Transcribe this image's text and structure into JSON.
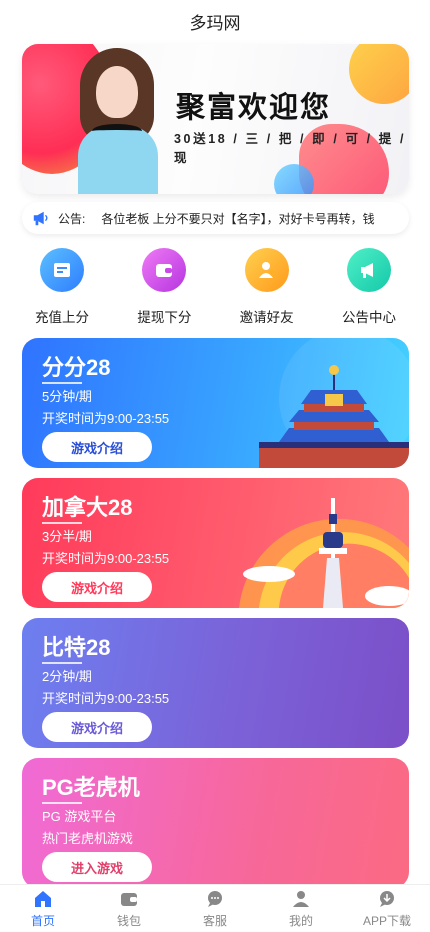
{
  "header": {
    "title": "多玛网"
  },
  "banner": {
    "title": "聚富欢迎您",
    "subtitle": "30送18 / 三 / 把 / 即 / 可 / 提 / 现"
  },
  "notice": {
    "label": "公告:",
    "text": "各位老板    上分不要只对【名字】，对好卡号再转，钱"
  },
  "quick_actions": [
    {
      "label": "充值上分",
      "icon": "recharge-icon",
      "color": "#3a9bff"
    },
    {
      "label": "提现下分",
      "icon": "wallet-icon",
      "color": "#d64be8"
    },
    {
      "label": "邀请好友",
      "icon": "invite-friend-icon",
      "color": "#ffad1f"
    },
    {
      "label": "公告中心",
      "icon": "megaphone-icon",
      "color": "#1fd3b0"
    }
  ],
  "games": [
    {
      "name": "分分28",
      "period": "5分钟/期",
      "hours": "开奖时间为9:00-23:55",
      "button": "游戏介绍",
      "art": "temple-of-heaven"
    },
    {
      "name": "加拿大28",
      "period": "3分半/期",
      "hours": "开奖时间为9:00-23:55",
      "button": "游戏介绍",
      "art": "cn-tower"
    },
    {
      "name": "比特28",
      "period": "2分钟/期",
      "hours": "开奖时间为9:00-23:55",
      "button": "游戏介绍",
      "art": ""
    },
    {
      "name": "PG老虎机",
      "period": "PG 游戏平台",
      "hours": "热门老虎机游戏",
      "button": "进入游戏",
      "art": ""
    }
  ],
  "tabbar": [
    {
      "label": "首页",
      "icon": "home-icon",
      "active": true
    },
    {
      "label": "钱包",
      "icon": "wallet-icon",
      "active": false
    },
    {
      "label": "客服",
      "icon": "chat-icon",
      "active": false
    },
    {
      "label": "我的",
      "icon": "user-icon",
      "active": false
    },
    {
      "label": "APP下载",
      "icon": "download-icon",
      "active": false
    }
  ],
  "colors": {
    "accent": "#2f73ff",
    "tab_inactive": "#888888"
  }
}
